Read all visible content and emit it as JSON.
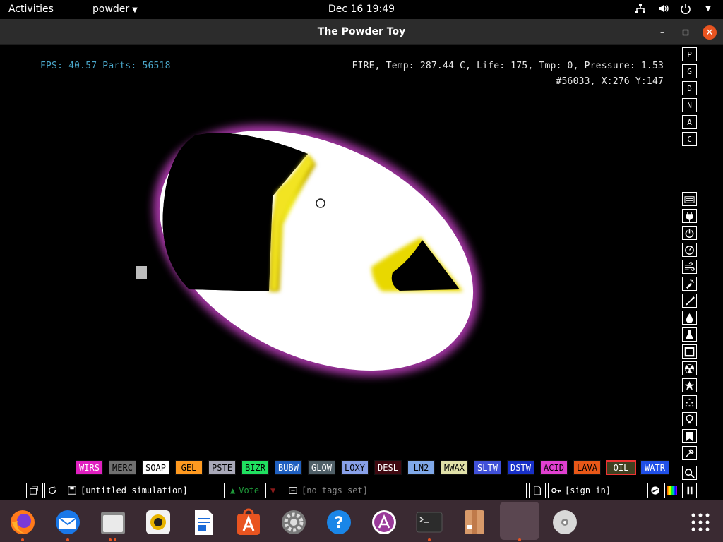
{
  "topbar": {
    "activities": "Activities",
    "app_menu": "powder",
    "clock": "Dec 16  19:49",
    "tray_icons": [
      "network-icon",
      "volume-icon",
      "power-icon",
      "chevron-down-icon"
    ]
  },
  "window": {
    "title": "The Powder Toy",
    "minimize": "–",
    "maximize": "▫",
    "close": "✕"
  },
  "hud": {
    "fps_text": "FPS: 40.57 Parts: 56518",
    "info_text": "FIRE, Temp: 287.44 C, Life: 175, Tmp: 0, Pressure: 1.53",
    "coords_text": "#56033, X:276 Y:147"
  },
  "right_menu_top": [
    "P",
    "G",
    "D",
    "N",
    "A",
    "C"
  ],
  "right_menu_icons": [
    "keyboard-icon",
    "plug-icon",
    "power-icon",
    "gauge-icon",
    "wind-icon",
    "spray-icon",
    "brush-icon",
    "drop-icon",
    "flask-icon",
    "square-icon",
    "radioactive-icon",
    "star-icon",
    "dots-icon",
    "lightbulb-icon",
    "bookmark-icon",
    "tools-icon",
    "search-icon"
  ],
  "elements": [
    {
      "label": "WIRS",
      "bg": "#e020c0",
      "fg": "#ffffff"
    },
    {
      "label": "MERC",
      "bg": "#707070",
      "fg": "#000000"
    },
    {
      "label": "SOAP",
      "bg": "#ffffff",
      "fg": "#000000"
    },
    {
      "label": "GEL",
      "bg": "#ff9a20",
      "fg": "#000000"
    },
    {
      "label": "PSTE",
      "bg": "#a8a8b8",
      "fg": "#000000"
    },
    {
      "label": "BIZR",
      "bg": "#20e060",
      "fg": "#000000"
    },
    {
      "label": "BUBW",
      "bg": "#2060c0",
      "fg": "#ffffff"
    },
    {
      "label": "GLOW",
      "bg": "#506068",
      "fg": "#ffffff"
    },
    {
      "label": "LOXY",
      "bg": "#88a0e8",
      "fg": "#000000"
    },
    {
      "label": "DESL",
      "bg": "#400810",
      "fg": "#ffffff"
    },
    {
      "label": "LN2",
      "bg": "#80a8e8",
      "fg": "#000000"
    },
    {
      "label": "MWAX",
      "bg": "#e0e0a8",
      "fg": "#000000"
    },
    {
      "label": "SLTW",
      "bg": "#4050d8",
      "fg": "#ffffff"
    },
    {
      "label": "DSTW",
      "bg": "#1830c8",
      "fg": "#ffffff"
    },
    {
      "label": "ACID",
      "bg": "#e040d0",
      "fg": "#000000"
    },
    {
      "label": "LAVA",
      "bg": "#e85818",
      "fg": "#000000"
    },
    {
      "label": "OIL",
      "bg": "#404020",
      "fg": "#ffffff",
      "selected": true
    },
    {
      "label": "WATR",
      "bg": "#2050e8",
      "fg": "#ffffff"
    }
  ],
  "bottom_bar": {
    "save_title": "[untitled simulation]",
    "vote_label": "Vote",
    "tags": "[no tags set]",
    "sign_in": "[sign in]"
  },
  "dock": [
    "firefox-icon",
    "thunderbird-icon",
    "files-icon",
    "rhythmbox-icon",
    "writer-icon",
    "software-center-icon",
    "settings-icon",
    "help-icon",
    "amarok-icon",
    "terminal-icon",
    "archive-icon",
    "powder-toy-icon",
    "disc-icon",
    "app-grid-icon"
  ],
  "colors": {
    "accent": "#e95420",
    "hud_blue": "#4aa6c9",
    "dock_bg": "#3a2a32"
  }
}
